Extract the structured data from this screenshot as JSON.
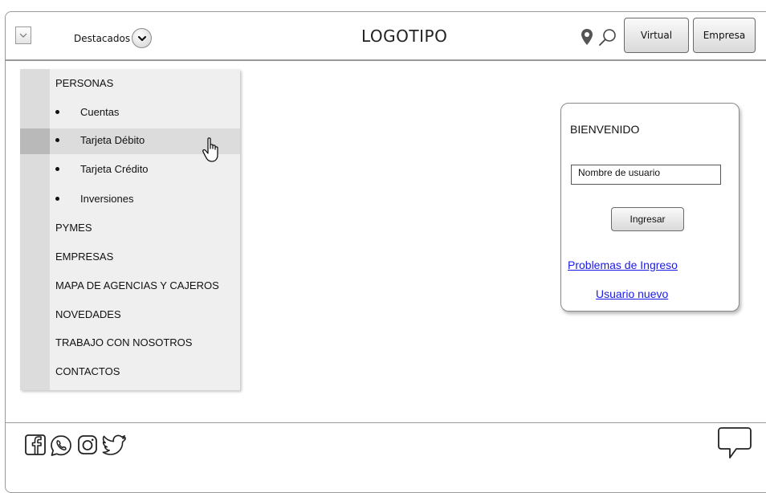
{
  "header": {
    "featured_label": "Destacados",
    "logo_text": "LOGOTIPO",
    "virtual_label": "Virtual",
    "empresa_label": "Empresa"
  },
  "sidebar": {
    "sections": [
      {
        "label": "PERSONAS"
      },
      {
        "label": "PYMES"
      },
      {
        "label": "EMPRESAS"
      },
      {
        "label": "MAPA DE AGENCIAS Y CAJEROS"
      },
      {
        "label": "NOVEDADES"
      },
      {
        "label": "TRABAJO CON NOSOTROS"
      },
      {
        "label": "CONTACTOS"
      }
    ],
    "personas_items": [
      {
        "label": "Cuentas"
      },
      {
        "label": "Tarjeta Débito"
      },
      {
        "label": "Tarjeta Crédito"
      },
      {
        "label": "Inversiones"
      }
    ]
  },
  "login": {
    "title": "BIENVENIDO",
    "username_placeholder": "Nombre de usuario",
    "submit_label": "Ingresar",
    "problems_link": "Problemas de Ingreso",
    "new_user_link": "Usuario nuevo"
  },
  "footer": {
    "social_icons": [
      "facebook-icon",
      "whatsapp-icon",
      "instagram-icon",
      "twitter-icon"
    ],
    "chat_icon": "chat-bubble-icon"
  },
  "colors": {
    "link": "#1a1ae6",
    "sidebar_bg": "#efefef",
    "highlight": "#dcdcdc"
  }
}
